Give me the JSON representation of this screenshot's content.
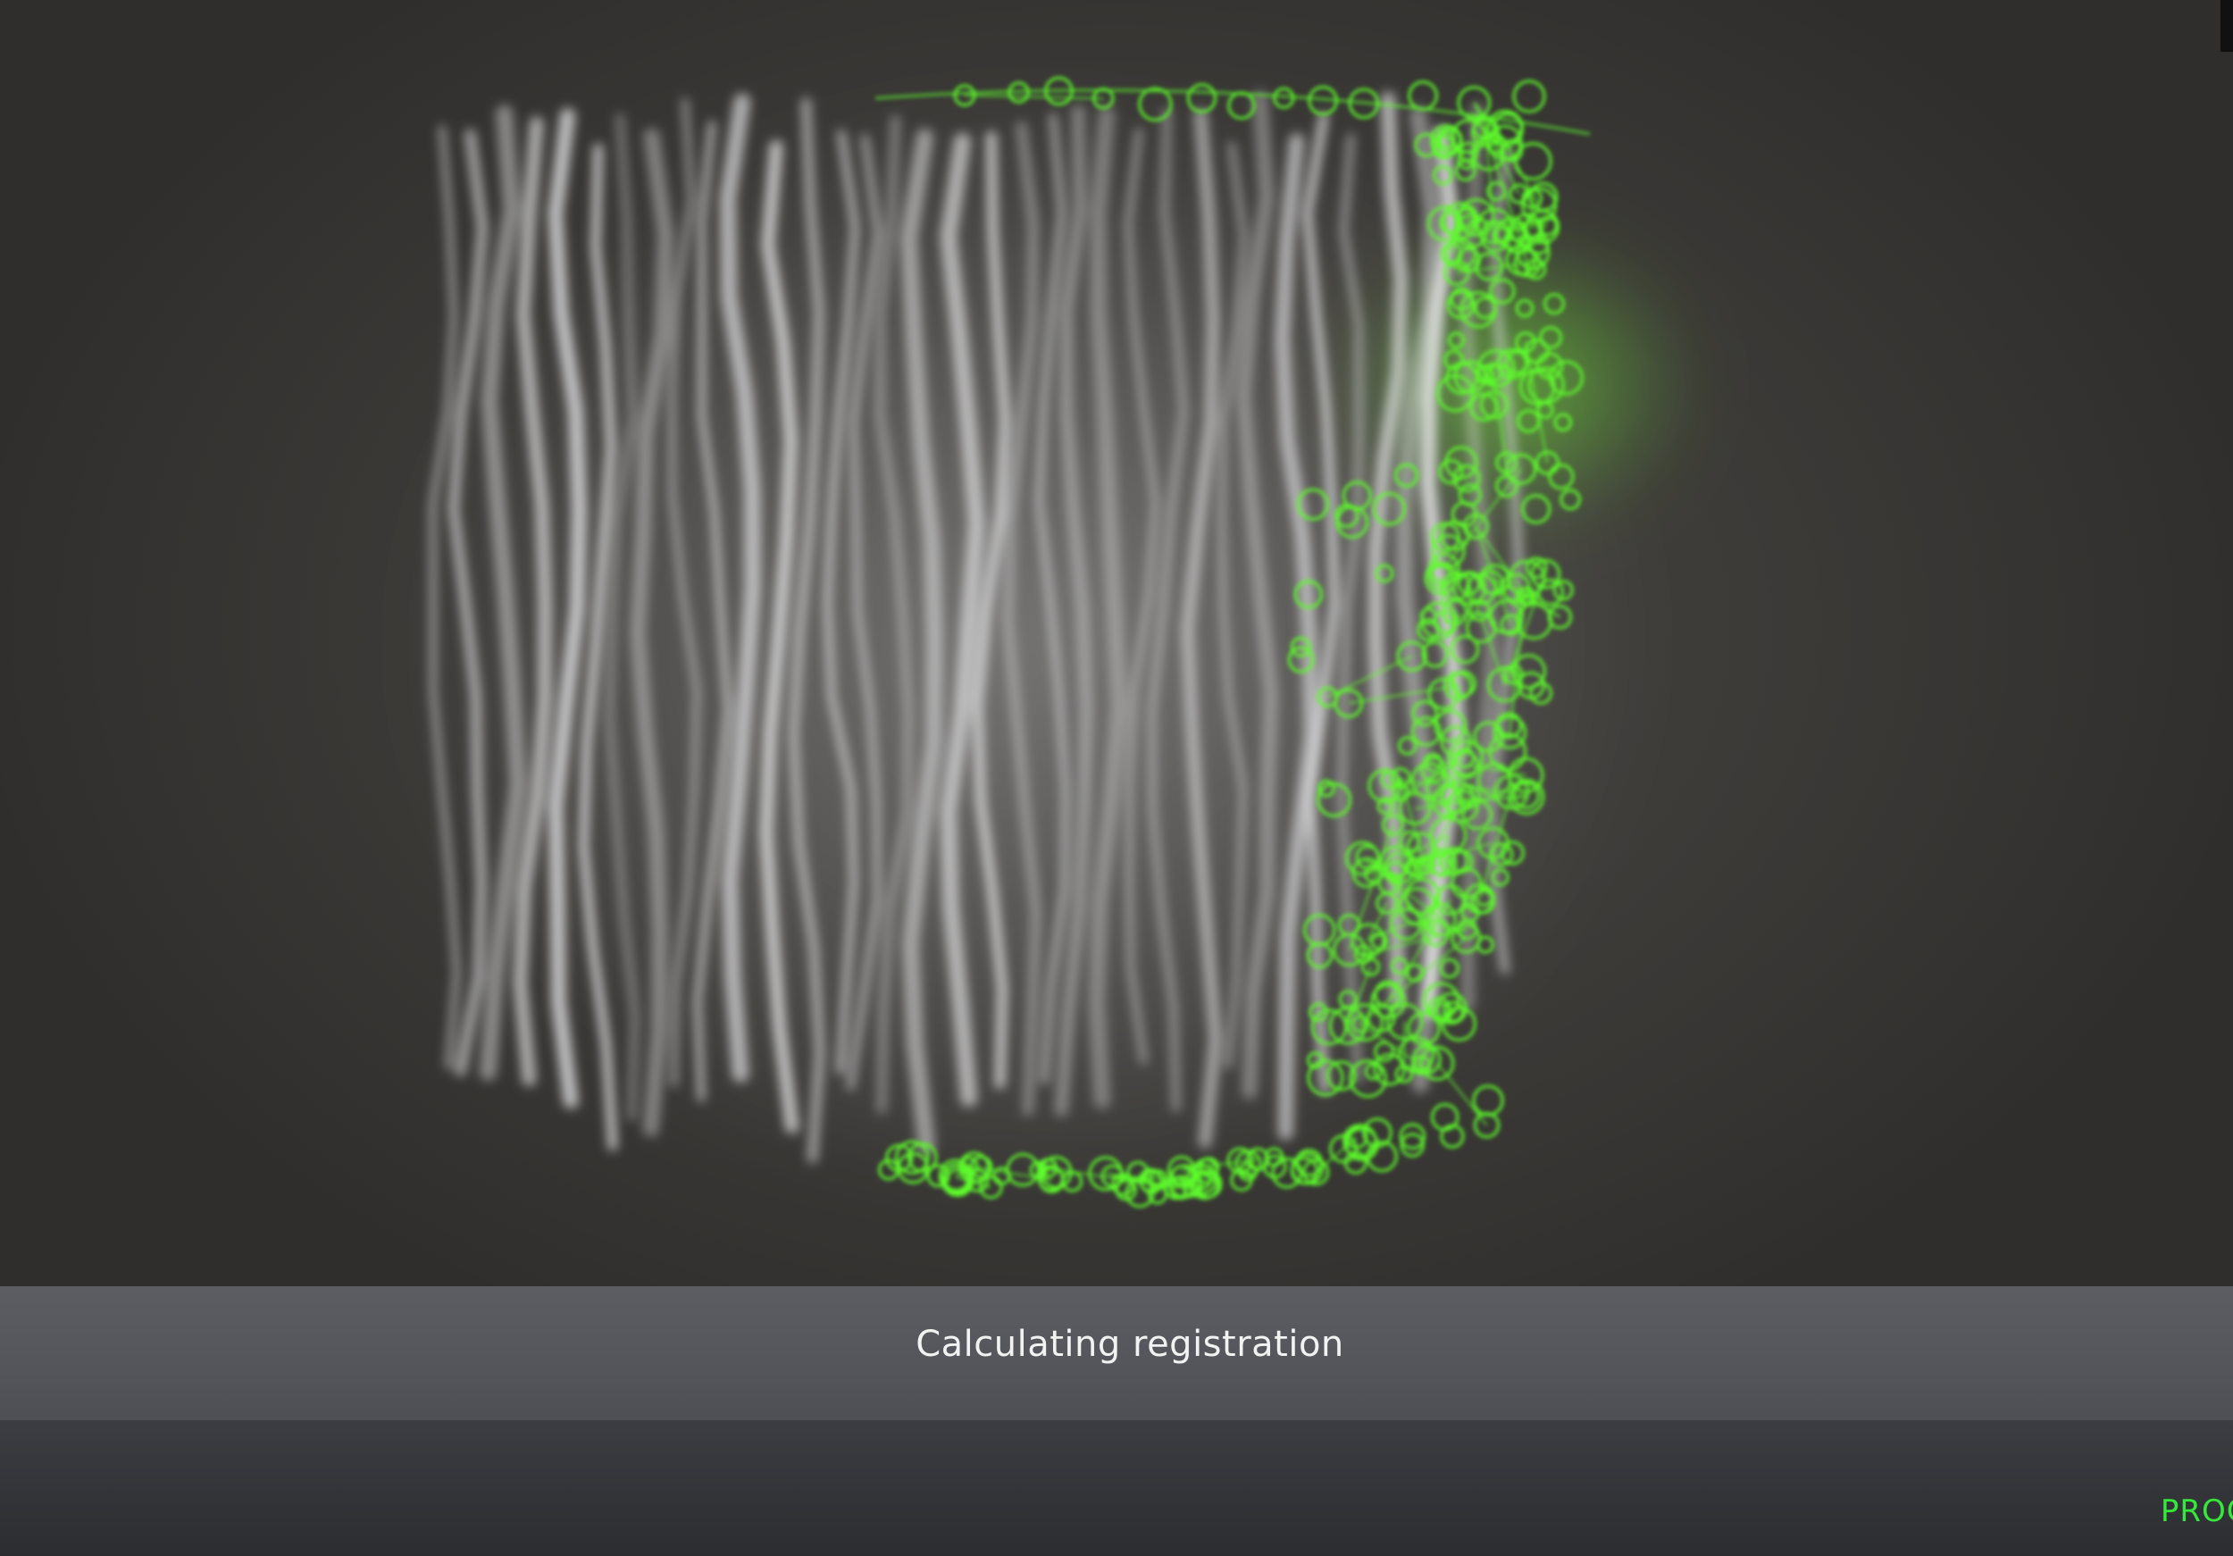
{
  "status": {
    "message": "Calculating registration"
  },
  "footer": {
    "state_label": "PROCE"
  },
  "colors": {
    "mesh": "#5dfc2c",
    "slices": "#e8e8ea",
    "status_text": "#f2f2f2",
    "state_label": "#36e83a"
  }
}
